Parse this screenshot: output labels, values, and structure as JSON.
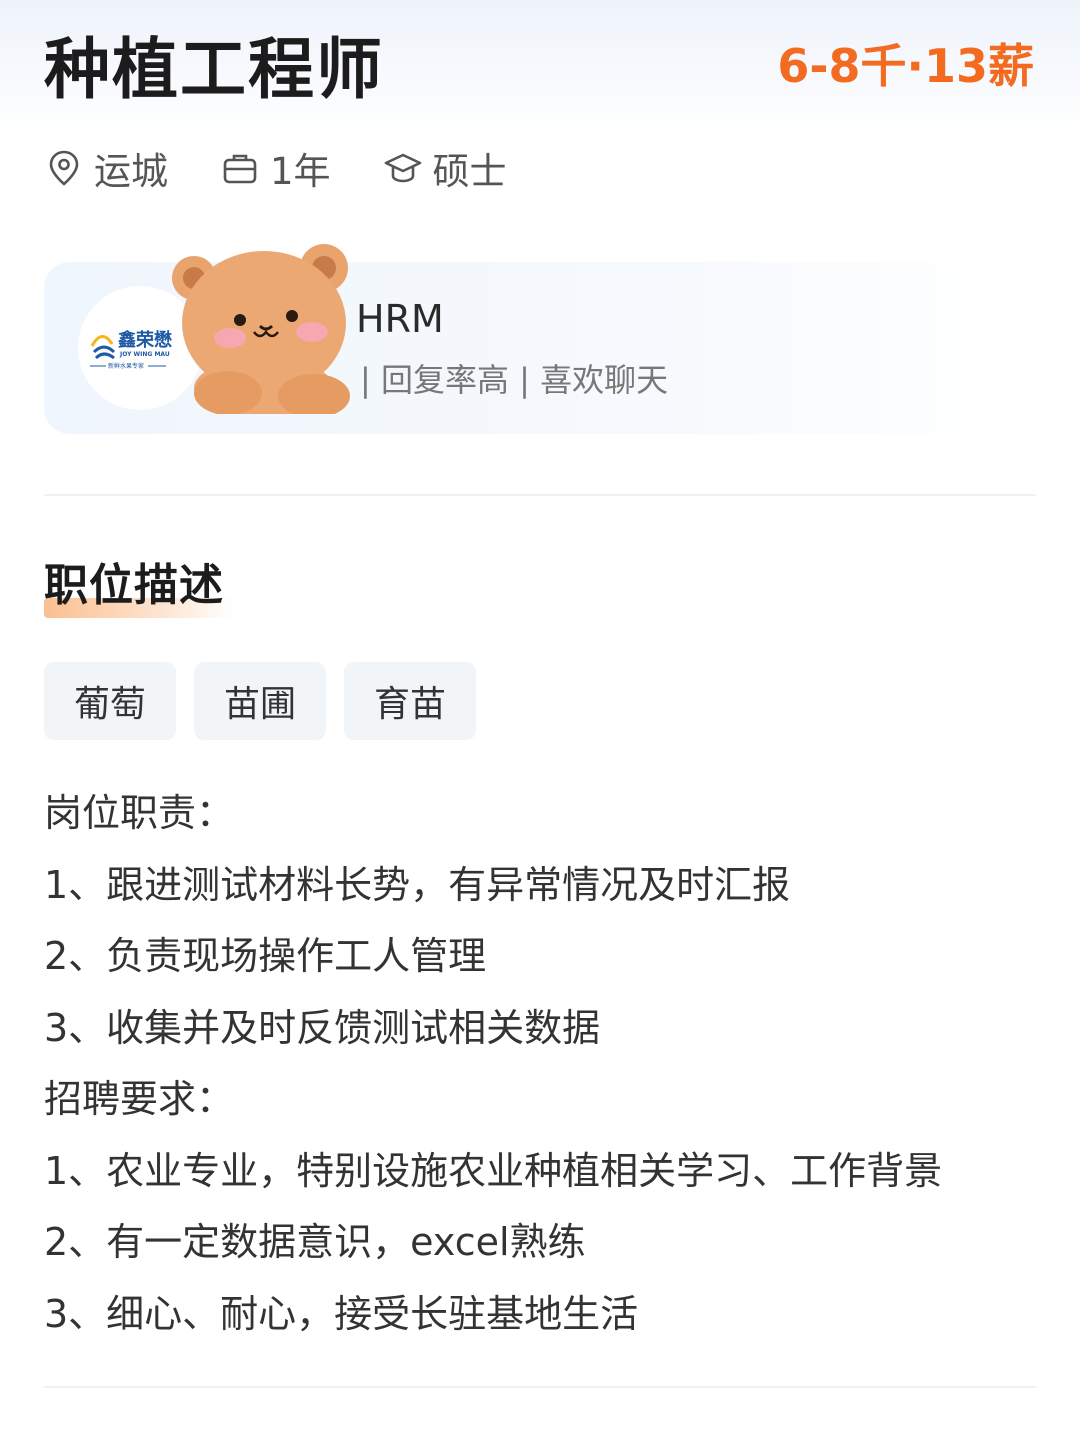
{
  "job": {
    "title": "种植工程师",
    "salary": "6-8千·13薪",
    "location": "运城",
    "experience": "1年",
    "education": "硕士"
  },
  "recruiter": {
    "name_visible": "HRM",
    "tags": "| 回复率高 | 喜欢聊天",
    "company_logo_text": "鑫荣懋",
    "company_logo_subtext": "JOY WING MAU",
    "company_logo_slogan": "新鲜水果专家"
  },
  "description": {
    "section_title": "职位描述",
    "tags": [
      "葡萄",
      "苗圃",
      "育苗"
    ],
    "lines": [
      "岗位职责：",
      "1、跟进测试材料长势，有异常情况及时汇报",
      "2、负责现场操作工人管理",
      "3、收集并及时反馈测试相关数据",
      "招聘要求：",
      "1、农业专业，特别设施农业种植相关学习、工作背景",
      "2、有一定数据意识，excel熟练",
      "3、细心、耐心，接受长驻基地生活"
    ]
  },
  "colors": {
    "salary": "#f26b21",
    "accent_underline": "#fbbf8f",
    "logo_blue": "#1f5aa6",
    "logo_yellow": "#f5b51b"
  }
}
